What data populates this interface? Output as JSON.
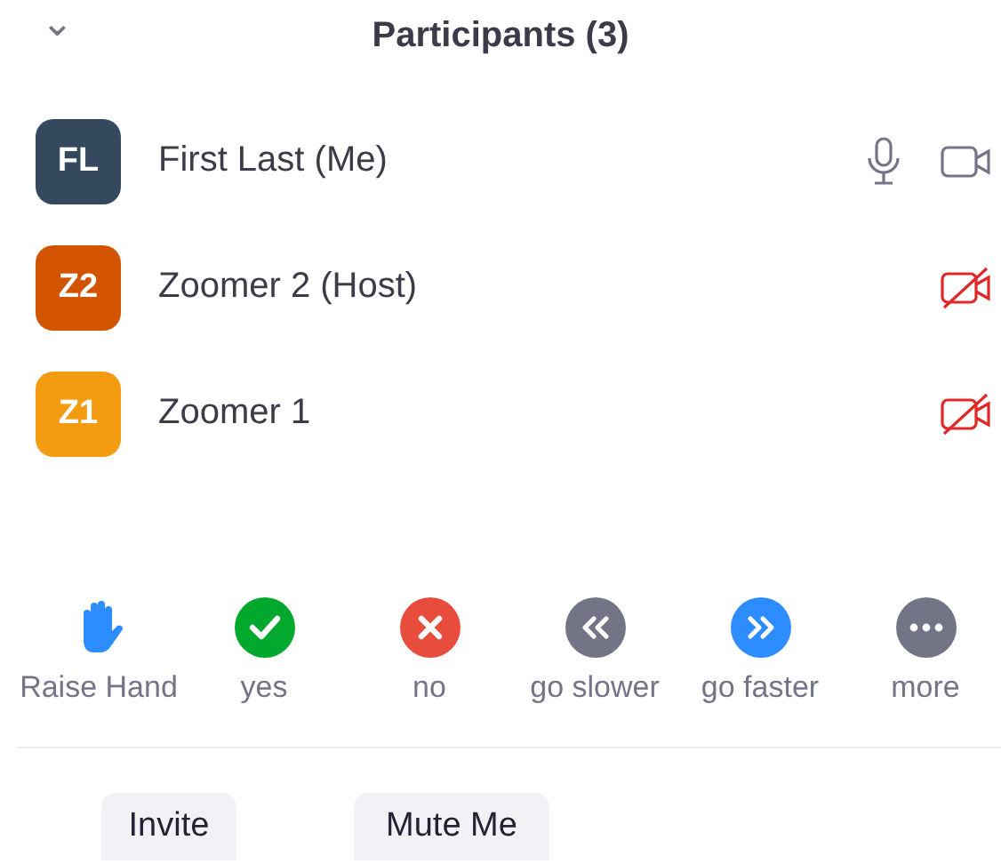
{
  "header": {
    "collapse_icon": "⌄",
    "title": "Participants (3)"
  },
  "participants": [
    {
      "initials": "FL",
      "name": "First Last (Me)",
      "color": "#34495e",
      "mic": true,
      "video_on": true
    },
    {
      "initials": "Z2",
      "name": "Zoomer 2 (Host)",
      "color": "#d35400",
      "mic": false,
      "video_on": false
    },
    {
      "initials": "Z1",
      "name": "Zoomer 1",
      "color": "#f39c12",
      "mic": false,
      "video_on": false
    }
  ],
  "reactions": [
    {
      "kind": "hand",
      "label": "Raise Hand",
      "color": "#2d8cff"
    },
    {
      "kind": "yes",
      "label": "yes",
      "color": "#00a82d"
    },
    {
      "kind": "no",
      "label": "no",
      "color": "#e74c3c"
    },
    {
      "kind": "slower",
      "label": "go slower",
      "color": "#747487"
    },
    {
      "kind": "faster",
      "label": "go faster",
      "color": "#2d8cff"
    },
    {
      "kind": "more",
      "label": "more",
      "color": "#747487"
    }
  ],
  "buttons": [
    "Invite",
    "Mute Me"
  ]
}
